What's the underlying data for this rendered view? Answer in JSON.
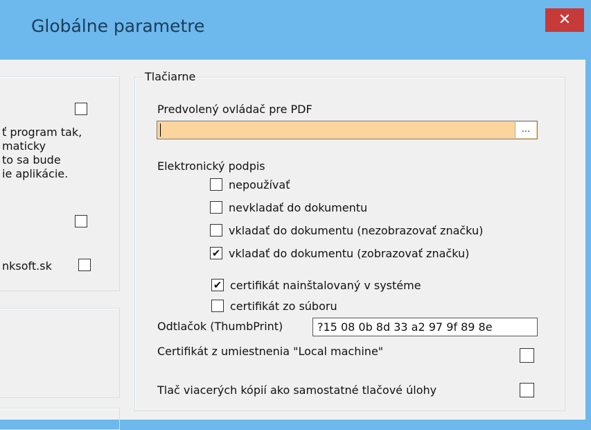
{
  "window": {
    "title": "Globálne parametre",
    "close_symbol": "✕"
  },
  "left_panel": {
    "text_lines": [
      "ť program tak,",
      "maticky",
      "to sa bude",
      "ie aplikácie."
    ],
    "domain_label": "nksoft.sk",
    "checkboxes": [
      false,
      false,
      false
    ]
  },
  "printers": {
    "legend": "Tlačiarne",
    "pdf_driver_label": "Predvolený ovládač pre PDF",
    "pdf_driver_value": "",
    "pdf_button": "...",
    "esign_label": "Elektronický podpis",
    "options": [
      {
        "label": "nepoužívať",
        "checked": false
      },
      {
        "label": "nevkladať do dokumentu",
        "checked": false
      },
      {
        "label": "vkladať do dokumentu (nezobrazovať značku)",
        "checked": false
      },
      {
        "label": "vkladať do dokumentu (zobrazovať značku)",
        "checked": true
      }
    ],
    "cert_options": [
      {
        "label": "certifikát nainštalovaný v systéme",
        "checked": true
      },
      {
        "label": "certifikát zo súboru",
        "checked": false
      }
    ],
    "thumbprint_label": "Odtlačok (ThumbPrint)",
    "thumbprint_value": "?15 08 0b 8d 33 a2 97 9f 89 8e",
    "local_machine_label": "Certifikát z umiestnenia \"Local machine\"",
    "local_machine_checked": false,
    "multi_copy_label": "Tlač viacerých kópií ako samostatné tlačové úlohy",
    "multi_copy_checked": false
  },
  "colors": {
    "title_bg": "#6db8ec",
    "close_bg": "#c73a3a",
    "input_highlight": "#fbd59d"
  }
}
